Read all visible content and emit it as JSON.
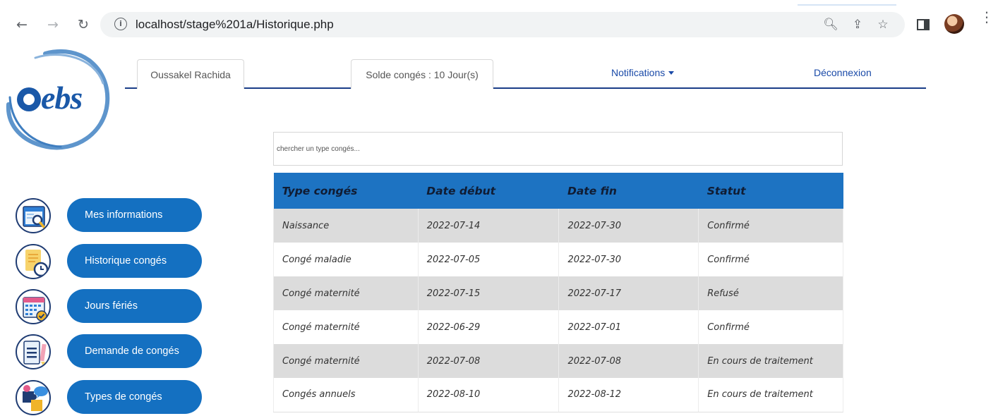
{
  "browser": {
    "url": "localhost/stage%201a/Historique.php"
  },
  "logo": {
    "text": "ebs"
  },
  "topnav": {
    "user_name": "Oussakel Rachida",
    "balance": "Solde congés : 10 Jour(s)",
    "notifications": "Notifications",
    "logout": "Déconnexion"
  },
  "search": {
    "placeholder": "chercher un type congés..."
  },
  "table": {
    "headers": [
      "Type congés",
      "Date début",
      "Date fin",
      "Statut"
    ],
    "rows": [
      [
        "Naissance",
        "2022-07-14",
        "2022-07-30",
        "Confirmé"
      ],
      [
        "Congé maladie",
        "2022-07-05",
        "2022-07-30",
        "Confirmé"
      ],
      [
        "Congé maternité",
        "2022-07-15",
        "2022-07-17",
        "Refusé"
      ],
      [
        "Congé maternité",
        "2022-06-29",
        "2022-07-01",
        "Confirmé"
      ],
      [
        "Congé maternité",
        "2022-07-08",
        "2022-07-08",
        "En cours de traitement"
      ],
      [
        "Congés annuels",
        "2022-08-10",
        "2022-08-12",
        "En cours de traitement"
      ]
    ]
  },
  "sidebar": {
    "items": [
      {
        "label": "Mes informations",
        "icon": "browser-magnifier-icon"
      },
      {
        "label": "Historique congés",
        "icon": "document-clock-icon"
      },
      {
        "label": "Jours fériés",
        "icon": "calendar-check-icon"
      },
      {
        "label": "Demande de congés",
        "icon": "document-pencil-icon"
      },
      {
        "label": "Types de congés",
        "icon": "puzzle-chat-icon"
      }
    ]
  },
  "colors": {
    "accent": "#1470c1",
    "table_header": "#1d73c2",
    "row_stripe": "#dcdcdc",
    "logo_blue": "#1a58a8"
  }
}
